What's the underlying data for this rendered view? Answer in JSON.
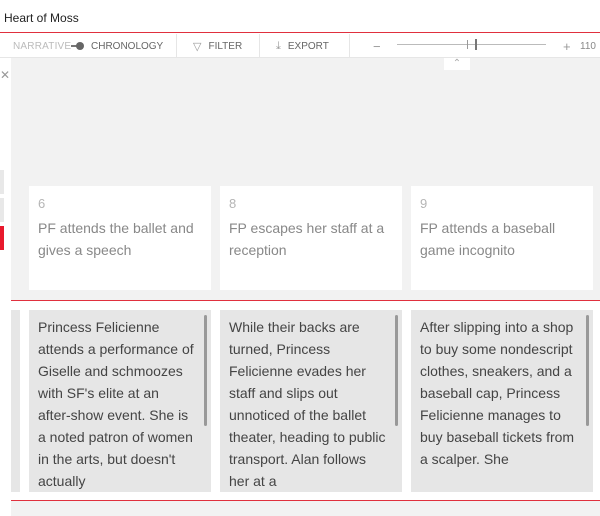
{
  "window": {
    "title": "Heart of Moss"
  },
  "toolbar": {
    "narrative_label": "NARRATIVE",
    "chronology_label": "CHRONOLOGY",
    "mode_selected": "chronology",
    "filter_label": "FILTER",
    "filter_icon": "funnel-icon",
    "export_label": "EXPORT",
    "export_icon": "download-icon",
    "zoom_minus": "−",
    "zoom_plus": "+",
    "zoom_value": "110"
  },
  "canvas": {
    "collapse_icon": "⌃",
    "left_panel_close": "✕",
    "beats": [
      {
        "number": "6",
        "heading": "PF attends the ballet and gives a speech",
        "description": "Princess Felicienne attends a performance of Giselle and schmoozes with SF's elite at an after-show event. She is a noted patron of women in the arts, but doesn't actually"
      },
      {
        "number": "8",
        "heading": "FP escapes her staff at a reception",
        "description": "While their backs are turned, Princess Felicienne evades her staff and slips out unnoticed of the ballet theater, heading to public transport. Alan follows her at a"
      },
      {
        "number": "9",
        "heading": "FP attends a baseball game incognito",
        "description": "After slipping into a shop to buy some nondescript clothes, sneakers, and a baseball cap, Princess Felicienne manages to buy baseball tickets from a scalper. She"
      }
    ]
  },
  "colors": {
    "accent": "#e0303e",
    "active_tab": "#e8192c"
  }
}
